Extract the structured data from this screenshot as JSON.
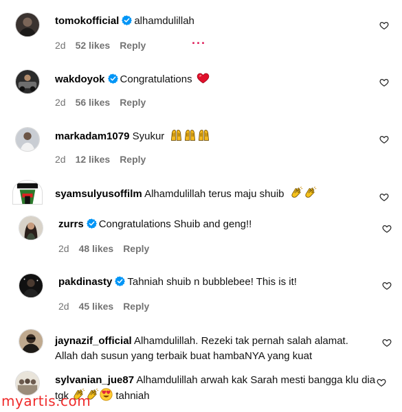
{
  "comments": [
    {
      "username": "tomokofficial",
      "verified": true,
      "text": "alhamdulillah",
      "time": "2d",
      "likes": "52 likes",
      "reply": "Reply"
    },
    {
      "username": "wakdoyok",
      "verified": true,
      "text": "Congratulations",
      "time": "2d",
      "likes": "56 likes",
      "reply": "Reply"
    },
    {
      "username": "markadam1079",
      "verified": false,
      "text": "Syukur",
      "time": "2d",
      "likes": "12 likes",
      "reply": "Reply"
    },
    {
      "username": "syamsulyusoffilm",
      "verified": false,
      "text": "Alhamdulillah terus maju shuib"
    },
    {
      "username": "zurrs",
      "verified": true,
      "text": "Congratulations Shuib and geng!!",
      "time": "2d",
      "likes": "48 likes",
      "reply": "Reply"
    },
    {
      "username": "pakdinasty",
      "verified": true,
      "text": "Tahniah shuib n bubblebee! This is it!",
      "time": "2d",
      "likes": "45 likes",
      "reply": "Reply"
    },
    {
      "username": "jaynazif_official",
      "verified": false,
      "text": "Alhamdulillah. Rezeki tak pernah salah alamat. Allah dah susun yang terbaik buat hambaNYA yang kuat"
    },
    {
      "username": "sylvanian_jue87",
      "verified": false,
      "text": "Alhamdulillah arwah kak Sarah mesti bangga klu dia tgk",
      "text_after": "tahniah"
    }
  ],
  "loading_dots": "...",
  "watermark": "myartis.com",
  "icons": {
    "verified": "verified-badge-icon",
    "like": "heart-outline-icon",
    "red_heart": "red-heart-emoji",
    "praying": "raising-hands-emoji",
    "clap": "clapping-hands-emoji",
    "heart_eyes": "heart-eyes-emoji"
  },
  "colors": {
    "verified": "#0095f6",
    "meta": "#737373",
    "watermark": "#ef2b2b",
    "dots": "#e0245e"
  }
}
